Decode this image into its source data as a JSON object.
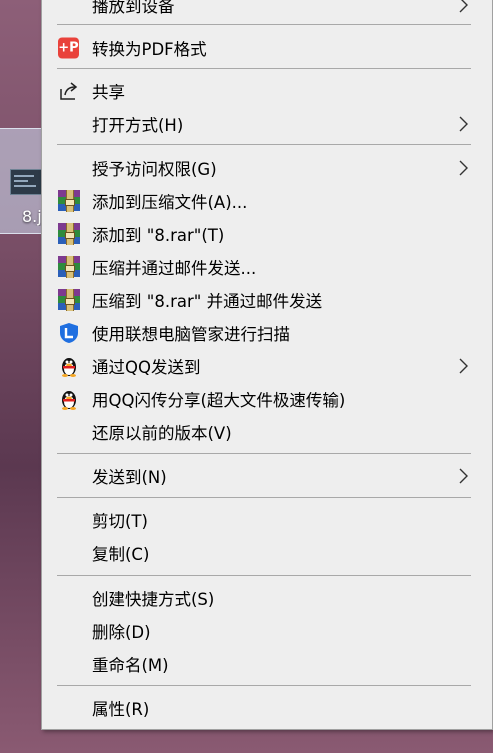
{
  "desktop": {
    "file_label": "8.j"
  },
  "menu": {
    "items": [
      {
        "label": "播放到设备",
        "submenu": true
      },
      {
        "label": "转换为PDF格式",
        "icon": "pdf-icon"
      },
      {
        "label": "共享",
        "icon": "share-icon"
      },
      {
        "label": "打开方式(H)",
        "submenu": true
      },
      {
        "label": "授予访问权限(G)",
        "submenu": true
      },
      {
        "label": "添加到压缩文件(A)...",
        "icon": "winrar-icon"
      },
      {
        "label": "添加到 \"8.rar\"(T)",
        "icon": "winrar-icon"
      },
      {
        "label": "压缩并通过邮件发送...",
        "icon": "winrar-icon"
      },
      {
        "label": "压缩到 \"8.rar\" 并通过邮件发送",
        "icon": "winrar-icon"
      },
      {
        "label": "使用联想电脑管家进行扫描",
        "icon": "lenovo-shield-icon"
      },
      {
        "label": "通过QQ发送到",
        "icon": "qq-penguin-icon",
        "submenu": true
      },
      {
        "label": "用QQ闪传分享(超大文件极速传输)",
        "icon": "qq-penguin-icon"
      },
      {
        "label": "还原以前的版本(V)"
      },
      {
        "label": "发送到(N)",
        "submenu": true
      },
      {
        "label": "剪切(T)"
      },
      {
        "label": "复制(C)"
      },
      {
        "label": "创建快捷方式(S)"
      },
      {
        "label": "删除(D)"
      },
      {
        "label": "重命名(M)"
      },
      {
        "label": "属性(R)"
      }
    ]
  },
  "colors": {
    "menu_bg": "#eeeeee",
    "separator": "#a8a8a8",
    "pdf_red": "#e9423b",
    "lenovo_blue": "#1f6fe0"
  }
}
